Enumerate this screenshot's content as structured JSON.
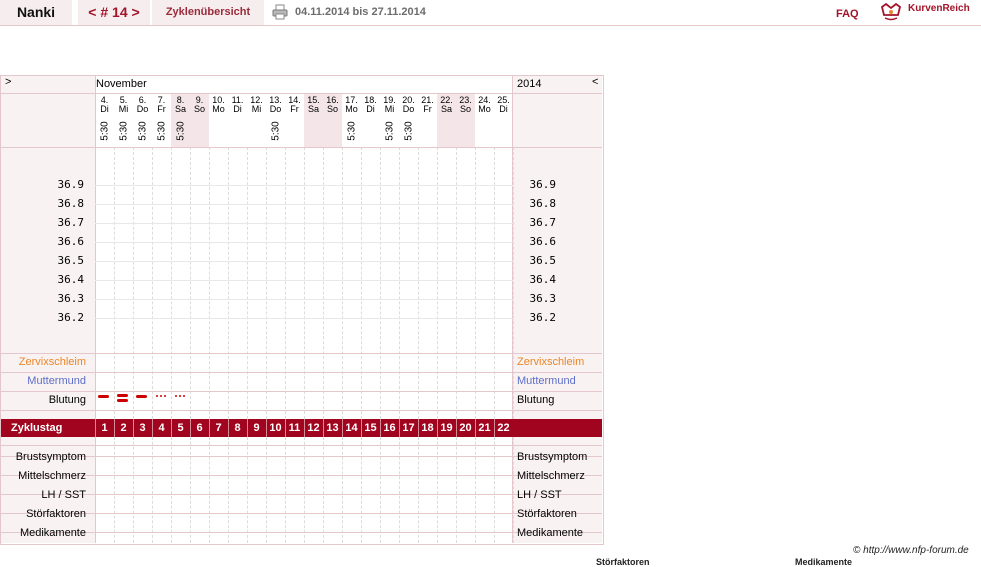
{
  "header": {
    "user": "Nanki",
    "cycle_nav": "< # 14 >",
    "overview_label": "Zyklenübersicht",
    "print_icon": "printer-icon",
    "date_range": "04.11.2014 bis 27.11.2014",
    "faq": "FAQ",
    "brand_icon": "kurvenreich-logo-icon",
    "brand": "KurvenReich"
  },
  "chart": {
    "nav_prev": ">",
    "nav_next": "<",
    "month": "November",
    "year": "2014",
    "days": [
      {
        "num": "4.",
        "wd": "Di",
        "time": "5:30",
        "weekend": false
      },
      {
        "num": "5.",
        "wd": "Mi",
        "time": "5:30",
        "weekend": false
      },
      {
        "num": "6.",
        "wd": "Do",
        "time": "5:30",
        "weekend": false
      },
      {
        "num": "7.",
        "wd": "Fr",
        "time": "5:30",
        "weekend": false
      },
      {
        "num": "8.",
        "wd": "Sa",
        "time": "5:30",
        "weekend": true
      },
      {
        "num": "9.",
        "wd": "So",
        "time": "",
        "weekend": true
      },
      {
        "num": "10.",
        "wd": "Mo",
        "time": "",
        "weekend": false
      },
      {
        "num": "11.",
        "wd": "Di",
        "time": "",
        "weekend": false
      },
      {
        "num": "12.",
        "wd": "Mi",
        "time": "",
        "weekend": false
      },
      {
        "num": "13.",
        "wd": "Do",
        "time": "5:30",
        "weekend": false
      },
      {
        "num": "14.",
        "wd": "Fr",
        "time": "",
        "weekend": false
      },
      {
        "num": "15.",
        "wd": "Sa",
        "time": "",
        "weekend": true
      },
      {
        "num": "16.",
        "wd": "So",
        "time": "",
        "weekend": true
      },
      {
        "num": "17.",
        "wd": "Mo",
        "time": "5:30",
        "weekend": false
      },
      {
        "num": "18.",
        "wd": "Di",
        "time": "",
        "weekend": false
      },
      {
        "num": "19.",
        "wd": "Mi",
        "time": "5:30",
        "weekend": false
      },
      {
        "num": "20.",
        "wd": "Do",
        "time": "5:30",
        "weekend": false
      },
      {
        "num": "21.",
        "wd": "Fr",
        "time": "",
        "weekend": false
      },
      {
        "num": "22.",
        "wd": "Sa",
        "time": "",
        "weekend": true
      },
      {
        "num": "23.",
        "wd": "So",
        "time": "",
        "weekend": true
      },
      {
        "num": "24.",
        "wd": "Mo",
        "time": "",
        "weekend": false
      },
      {
        "num": "25.",
        "wd": "Di",
        "time": "",
        "weekend": false
      }
    ],
    "temperatures": [
      "36.9",
      "36.8",
      "36.7",
      "36.6",
      "36.5",
      "36.4",
      "36.3",
      "36.2"
    ],
    "rows_top": [
      {
        "label": "Zervixschleim",
        "color_class": "c-cervix"
      },
      {
        "label": "Muttermund",
        "color_class": "c-cervmouth"
      },
      {
        "label": "Blutung",
        "color_class": ""
      }
    ],
    "bleeding": [
      {
        "day": 1,
        "type": "strong"
      },
      {
        "day": 2,
        "type": "very-strong"
      },
      {
        "day": 3,
        "type": "strong"
      },
      {
        "day": 4,
        "type": "spotting"
      },
      {
        "day": 5,
        "type": "spotting"
      }
    ],
    "cycle_title": "Zyklustag",
    "cycle_days": [
      "1",
      "2",
      "3",
      "4",
      "5",
      "6",
      "7",
      "8",
      "9",
      "10",
      "11",
      "12",
      "13",
      "14",
      "15",
      "16",
      "17",
      "18",
      "19",
      "20",
      "21",
      "22"
    ],
    "rows_bottom": [
      "Brustsymptom",
      "Mittelschmerz",
      "LH / SST",
      "Störfaktoren",
      "Medikamente"
    ]
  },
  "colors": {
    "accent": "#a0041e",
    "weekend": "#f4e6e8",
    "panel": "#f9f2f2",
    "cervix": "#e98628",
    "cervmouth": "#5d6ec8",
    "bleeding": "#cc0000"
  },
  "footer": {
    "copyright": "© http://www.nfp-forum.de",
    "cut_left": "Störfaktoren",
    "cut_right": "Medikamente"
  }
}
